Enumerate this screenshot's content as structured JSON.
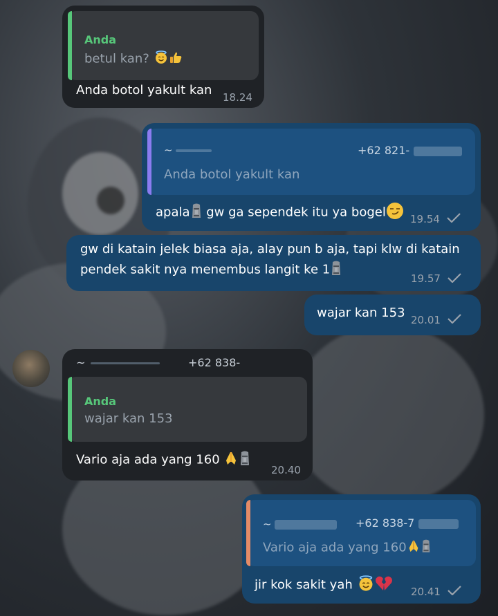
{
  "colors": {
    "incoming_bubble": "#1f2226",
    "outgoing_bubble": "#18456b",
    "reply_green": "#57c77a",
    "reply_purple": "#8b7cf0",
    "reply_orange": "#e38b67",
    "check_color": "#9aa3ad"
  },
  "messages": [
    {
      "direction": "incoming",
      "reply": {
        "name": "Anda",
        "text": "betul kan?",
        "emoji": [
          "smiling-halo-emoji",
          "thumbs-up-emoji"
        ]
      },
      "text": "Anda botol yakult kan",
      "time": "18.24"
    },
    {
      "direction": "outgoing",
      "reply": {
        "name": "~ ",
        "phone": "+62 821-",
        "text": "Anda botol yakult kan"
      },
      "text_a": "apala",
      "text_b": " gw ga sependek itu ya bogel",
      "emoji": [
        "moai-emoji",
        "smirk-emoji"
      ],
      "time": "19.54"
    },
    {
      "direction": "outgoing",
      "line1": "gw di katain jelek biasa aja, alay pun b aja, tapi klw di katain",
      "line2": "pendek sakit nya menembus langit ke 1",
      "emoji": [
        "moai-emoji"
      ],
      "time": "19.57"
    },
    {
      "direction": "outgoing",
      "text": "wajar kan 153",
      "time": "20.01"
    },
    {
      "direction": "incoming",
      "sender": {
        "name": "~",
        "phone": "+62 838-"
      },
      "reply": {
        "name": "Anda",
        "text": "wajar kan 153"
      },
      "text": "Vario aja ada yang 160",
      "emoji": [
        "pray-emoji",
        "moai-emoji"
      ],
      "time": "20.40"
    },
    {
      "direction": "outgoing",
      "reply": {
        "name": "~",
        "phone": "+62 838-7",
        "text": "Vario aja ada yang 160",
        "emoji": [
          "pray-emoji",
          "moai-emoji"
        ]
      },
      "text": "jir kok sakit yah",
      "emoji": [
        "smiling-halo-emoji",
        "broken-heart-emoji"
      ],
      "time": "20.41"
    }
  ]
}
